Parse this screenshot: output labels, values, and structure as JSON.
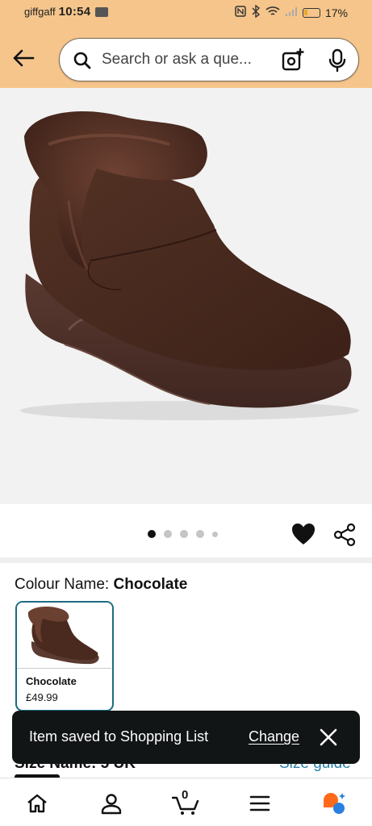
{
  "status_bar": {
    "carrier": "giffgaff",
    "time": "10:54",
    "battery": "17%"
  },
  "search": {
    "placeholder": "Search or ask a que..."
  },
  "carousel": {
    "image_count": 5,
    "active_index": 0
  },
  "colour": {
    "label": "Colour Name: ",
    "selected": "Chocolate",
    "swatch_name": "Chocolate",
    "swatch_price": "£49.99",
    "accent": "#1d6b82"
  },
  "size": {
    "label": "Size Name: 5 UK",
    "guide": "Size guide"
  },
  "toast": {
    "message": "Item saved to Shopping List",
    "action": "Change"
  },
  "bottom_nav": {
    "cart_count": "0"
  },
  "colors": {
    "header_bg": "#f5c58b",
    "toast_bg": "#121516",
    "product_bg": "#f2f2f2"
  }
}
